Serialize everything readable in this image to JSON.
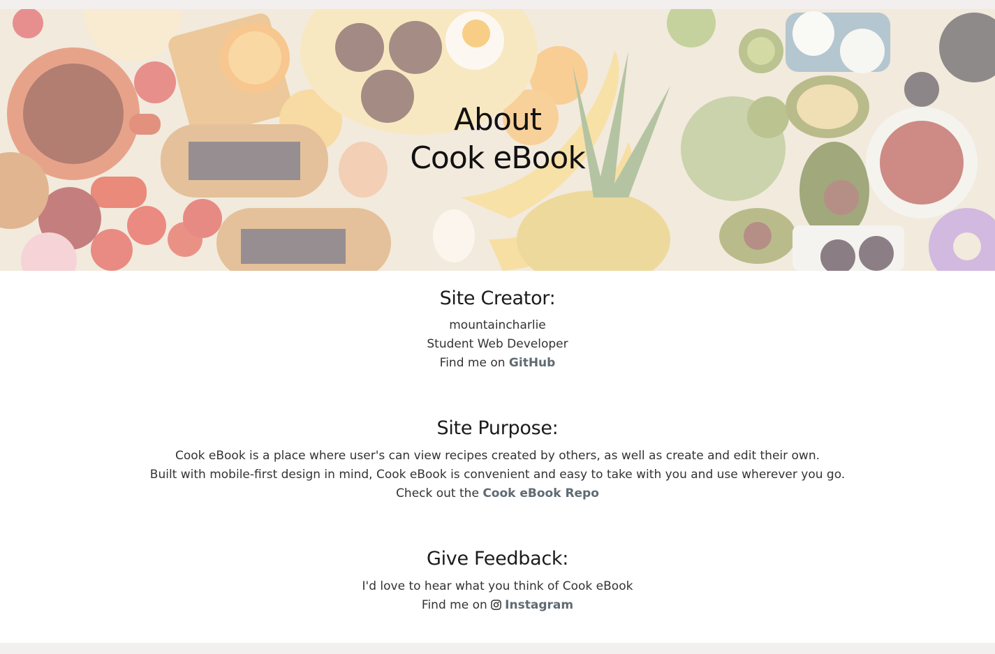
{
  "hero": {
    "title_line1": "About",
    "title_line2": "Cook eBook"
  },
  "creator": {
    "heading": "Site Creator:",
    "username": "mountaincharlie",
    "role": "Student Web Developer",
    "find_prefix": "Find me on ",
    "github_link": "GitHub"
  },
  "purpose": {
    "heading": "Site Purpose:",
    "line1": "Cook eBook is a place where user's can view recipes created by others, as well as create and edit their own.",
    "line2": "Built with mobile-first design in mind, Cook eBook is convenient and easy to take with you and use wherever you go.",
    "repo_prefix": "Check out the ",
    "repo_link": "Cook eBook Repo"
  },
  "feedback": {
    "heading": "Give Feedback:",
    "line1": "I'd love to hear what you think of Cook eBook",
    "find_prefix": "Find me on ",
    "instagram_link": "Instagram"
  },
  "colors": {
    "link": "#5f6a72",
    "strip": "#f3efee"
  }
}
